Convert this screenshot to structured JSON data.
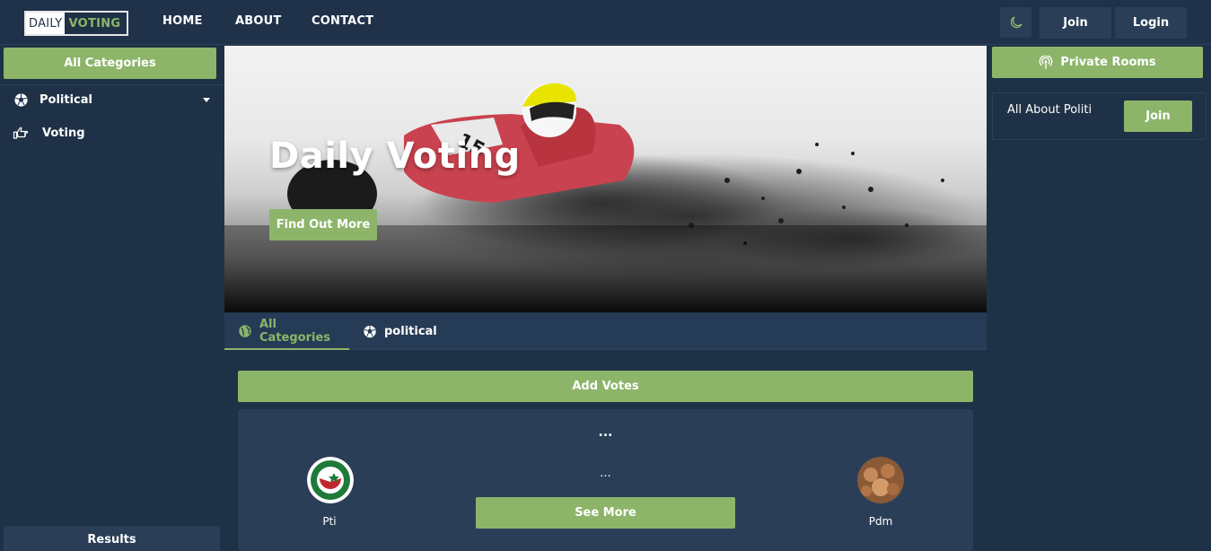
{
  "brand": {
    "part1": "DAILY",
    "part2": "VOTING"
  },
  "nav": {
    "home": "HOME",
    "about": "ABOUT",
    "contact": "CONTACT"
  },
  "header": {
    "join": "Join",
    "login": "Login",
    "theme_icon": "moon-icon"
  },
  "sidebar": {
    "categories_button": "All Categories",
    "items": [
      {
        "label": "Political",
        "icon": "soccer-ball-icon"
      },
      {
        "label": "Voting",
        "icon": "hand-point-right-icon"
      }
    ],
    "results_label": "Results"
  },
  "hero": {
    "title": "Daily Voting",
    "button": "Find Out More"
  },
  "tabs": [
    {
      "label": "All Categories",
      "icon": "globe-icon",
      "active": true
    },
    {
      "label": "political",
      "icon": "soccer-ball-icon",
      "active": false
    }
  ],
  "main": {
    "add_votes": "Add Votes",
    "vote_card": {
      "title": "...",
      "question": "...",
      "see_more": "See More",
      "left_party": "Pti",
      "right_party": "Pdm"
    }
  },
  "right": {
    "private_rooms": "Private Rooms",
    "room": {
      "title": "All About Politi",
      "join": "Join"
    }
  },
  "colors": {
    "accent": "#8db56a",
    "background": "#1f3146",
    "panel": "#2a3f57"
  }
}
